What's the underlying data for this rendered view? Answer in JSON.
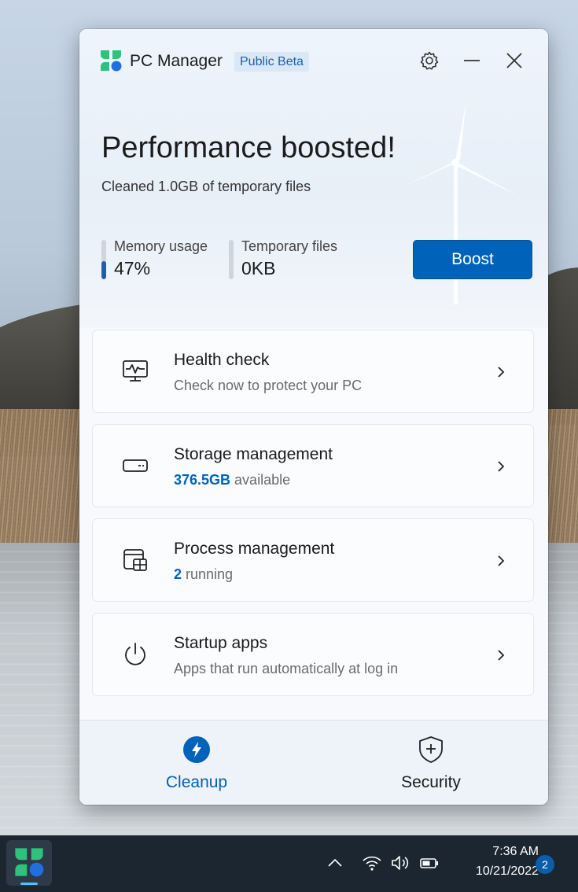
{
  "app": {
    "title": "PC Manager",
    "badge": "Public Beta"
  },
  "titlebar": {
    "settings_icon": "gear-icon",
    "minimize_icon": "minimize-icon",
    "close_icon": "close-icon"
  },
  "hero": {
    "title": "Performance boosted!",
    "subtitle": "Cleaned 1.0GB of temporary files"
  },
  "stats": {
    "memory": {
      "label": "Memory usage",
      "value": "47%",
      "level_fraction": 0.47
    },
    "temp": {
      "label": "Temporary files",
      "value": "0KB",
      "level_fraction": 0
    }
  },
  "boost_label": "Boost",
  "cards": [
    {
      "title": "Health check",
      "subtitle": "Check now to protect your PC",
      "icon": "health-monitor-icon"
    },
    {
      "title": "Storage management",
      "highlight": "376.5GB",
      "subtitle": " available",
      "icon": "storage-drive-icon"
    },
    {
      "title": "Process management",
      "highlight": "2",
      "subtitle": " running",
      "icon": "process-windows-icon"
    },
    {
      "title": "Startup apps",
      "subtitle": "Apps that run automatically at log in",
      "icon": "power-icon"
    }
  ],
  "nav": {
    "cleanup": {
      "label": "Cleanup",
      "active": true,
      "icon": "lightning-icon"
    },
    "security": {
      "label": "Security",
      "active": false,
      "icon": "shield-plus-icon"
    }
  },
  "taskbar": {
    "time": "7:36 AM",
    "date": "10/21/2022",
    "notification_count": "2"
  },
  "colors": {
    "accent": "#0062b8",
    "active_nav": "#0062b8",
    "taskbar": "#1c2631"
  }
}
